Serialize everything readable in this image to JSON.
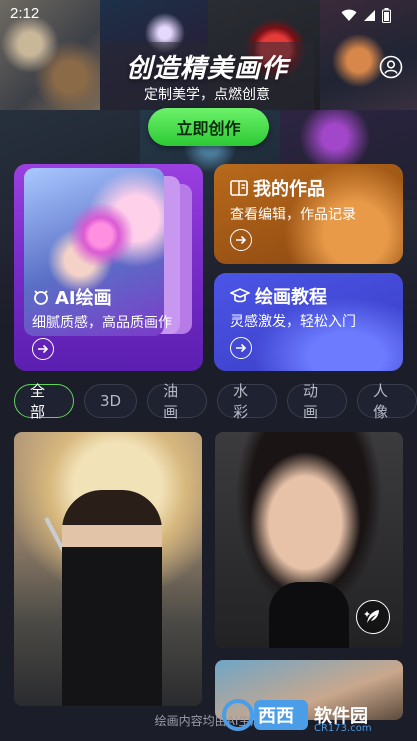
{
  "status": {
    "time": "2:12"
  },
  "hero": {
    "title": "创造精美画作",
    "subtitle": "定制美学，点燃创意",
    "cta_label": "立即创作"
  },
  "cards": {
    "ai": {
      "title": "AI绘画",
      "desc": "细腻质感，高品质画作"
    },
    "works": {
      "title": "我的作品",
      "desc": "查看编辑，作品记录"
    },
    "tutorial": {
      "title": "绘画教程",
      "desc": "灵感激发，轻松入门"
    }
  },
  "tabs": [
    {
      "label": "全部",
      "active": true
    },
    {
      "label": "3D",
      "active": false
    },
    {
      "label": "油画",
      "active": false
    },
    {
      "label": "水彩",
      "active": false
    },
    {
      "label": "动画",
      "active": false
    },
    {
      "label": "人像",
      "active": false
    }
  ],
  "footer": {
    "text": "绘画内容均由AI生成"
  },
  "watermark": {
    "brand": "西西软件园",
    "url": "CR173.com"
  },
  "colors": {
    "accent_green": "#4fd34a",
    "ai_card": "#8a35d8",
    "works_card": "#a85a18",
    "tutorial_card": "#4248d8",
    "background": "#1b1d28"
  },
  "icons": [
    "wifi-icon",
    "signal-icon",
    "battery-icon",
    "user-icon",
    "gallery-icon",
    "book-icon",
    "graduation-cap-icon",
    "arrow-right-icon",
    "quill-icon"
  ]
}
